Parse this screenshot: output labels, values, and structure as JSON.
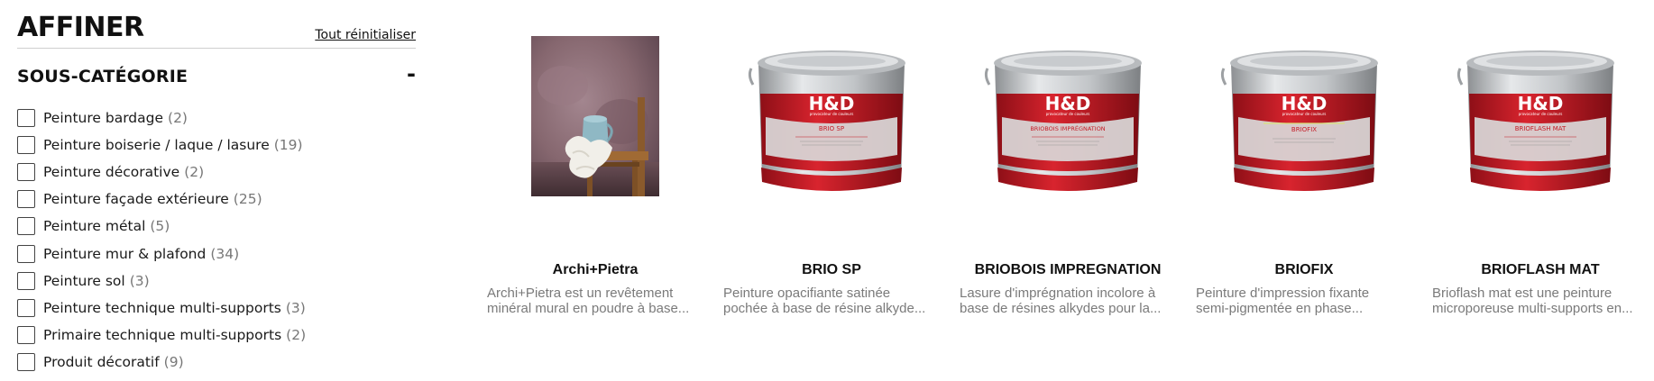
{
  "refine": {
    "title": "AFFINER",
    "reset_label": "Tout réinitialiser"
  },
  "subcategory": {
    "title": "SOUS-CATÉGORIE",
    "toggle_symbol": "-",
    "filters": [
      {
        "label": "Peinture bardage",
        "count": "(2)",
        "checked": false
      },
      {
        "label": "Peinture boiserie / laque / lasure",
        "count": "(19)",
        "checked": false
      },
      {
        "label": "Peinture décorative",
        "count": "(2)",
        "checked": false
      },
      {
        "label": "Peinture façade extérieure",
        "count": "(25)",
        "checked": false
      },
      {
        "label": "Peinture métal",
        "count": "(5)",
        "checked": false
      },
      {
        "label": "Peinture mur & plafond",
        "count": "(34)",
        "checked": false
      },
      {
        "label": "Peinture sol",
        "count": "(3)",
        "checked": false
      },
      {
        "label": "Peinture technique multi-supports",
        "count": "(3)",
        "checked": false
      },
      {
        "label": "Primaire technique multi-supports",
        "count": "(2)",
        "checked": false
      },
      {
        "label": "Produit décoratif",
        "count": "(9)",
        "checked": false
      }
    ]
  },
  "products": [
    {
      "name": "Archi+Pietra",
      "image": "decorative-wall-photo",
      "desc_line1": "Archi+Pietra est un revêtement",
      "desc_line2": "minéral mural en poudre à base..."
    },
    {
      "name": "BRIO SP",
      "image": "paint-bucket-icon",
      "can_label": "BRIO SP",
      "desc_line1": "Peinture opacifiante satinée",
      "desc_line2": "pochée à base de résine alkyde..."
    },
    {
      "name": "BRIOBOIS IMPREGNATION",
      "image": "paint-bucket-icon",
      "can_label": "BRIOBOIS IMPRÉGNATION",
      "desc_line1": "Lasure d'imprégnation incolore à",
      "desc_line2": "base de résines alkydes pour la..."
    },
    {
      "name": "BRIOFIX",
      "image": "paint-bucket-icon",
      "can_label": "BRIOFIX",
      "desc_line1": "Peinture d'impression fixante",
      "desc_line2": "semi-pigmentée en phase..."
    },
    {
      "name": "BRIOFLASH MAT",
      "image": "paint-bucket-icon",
      "can_label": "BRIOFLASH MAT",
      "desc_line1": "Brioflash mat est une peinture",
      "desc_line2": "microporeuse multi-supports en..."
    }
  ],
  "brand": {
    "logo_text": "H&D",
    "tagline": "provocateur de couleurs"
  },
  "colors": {
    "can_red": "#c41a24",
    "can_red_dark": "#8e0f17",
    "can_silver": "#c9cbcd",
    "text_muted": "#7a7a7a"
  }
}
